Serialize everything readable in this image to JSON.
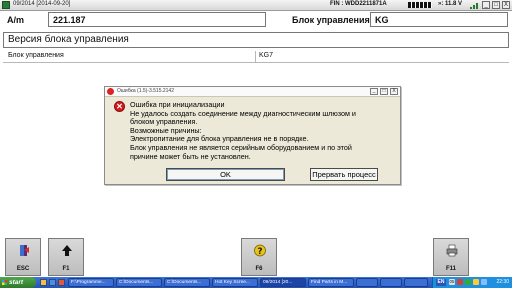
{
  "titlebar": {
    "title": "09/2014 [2014-09-20]",
    "fin": "FIN : WDD2211871A",
    "voltage": "»: 11.8 V",
    "minimize": "_",
    "maximize": "□",
    "close": "X"
  },
  "header": {
    "am_label": "A/m",
    "am_value": "221.187",
    "control_unit_label": "Блок управления",
    "control_unit_value": "KG"
  },
  "section": {
    "title": "Версия блока управления"
  },
  "table": {
    "col1": "Блок управления",
    "col2": "KG7"
  },
  "dialog": {
    "title": "Ошибка (1.5)-3.515.2142",
    "icon": "error-icon",
    "lines": [
      "Ошибка при инициализации",
      "Не удалось создать соединение между диагностическим шлюзом и",
      "блоком управления.",
      "Возможные причины:",
      "Электропитание для блока управления не в порядке.",
      "Блок управления не является серийным оборудованием и по этой",
      "причине может быть не установлен."
    ],
    "ok_label": "OK",
    "abort_label": "Прервать процесс"
  },
  "toolbar": {
    "esc": {
      "label": "ESC",
      "icon": "exit-icon"
    },
    "f1": {
      "label": "F1",
      "icon": "arrow-up-icon"
    },
    "f6": {
      "label": "F6",
      "icon": "help-icon"
    },
    "f11": {
      "label": "F11",
      "icon": "printer-icon"
    }
  },
  "taskbar": {
    "start": "start",
    "tasks": [
      "F:\\Programme...",
      "C:\\Documents...",
      "C:\\Documents...",
      "Hot Key Scree...",
      "09/2014 [20...",
      "Find Parts in M..."
    ],
    "lang": "EN",
    "clock": "22:30",
    "tray_number": "05"
  },
  "colors": {
    "taskbar": "#2452b5",
    "start": "#2f7a2c",
    "error": "#d51b1b",
    "dialog_bg": "#ece9d8"
  }
}
